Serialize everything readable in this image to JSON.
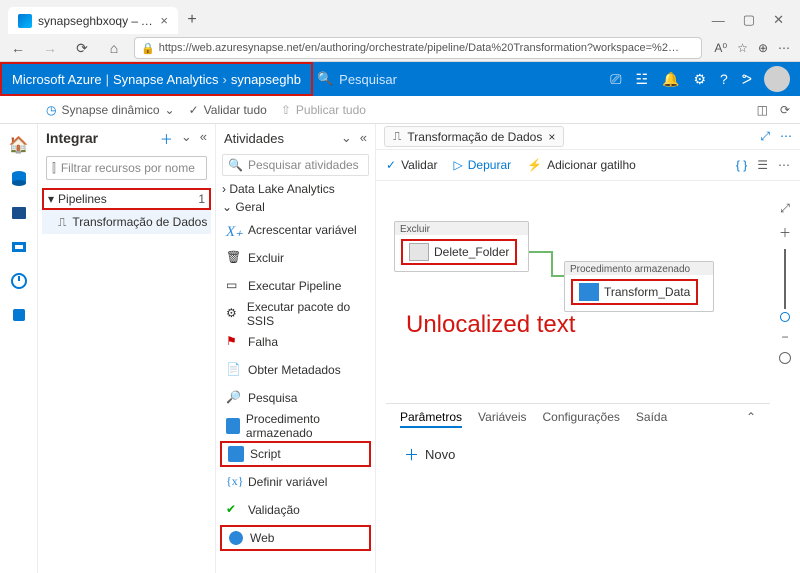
{
  "browser": {
    "tab_title": "synapseghbxoqy – Azure Synap…",
    "url": "https://web.azuresynapse.net/en/authoring/orchestrate/pipeline/Data%20Transformation?workspace=%2…"
  },
  "azure_bar": {
    "brand": "Microsoft Azure",
    "crumb1": "Synapse Analytics",
    "crumb2": "synapseghb",
    "search_placeholder": "Pesquisar"
  },
  "subbar": {
    "workspace": "Synapse dinâmico",
    "validate_all": "Validar tudo",
    "publish_all": "Publicar tudo"
  },
  "integrar": {
    "title": "Integrar",
    "filter_placeholder": "Filtrar recursos por nome",
    "pipelines_label": "Pipelines",
    "pipelines_count": "1",
    "pipeline_item": "Transformação de Dados"
  },
  "atividades": {
    "title": "Atividades",
    "search_placeholder": "Pesquisar atividades",
    "section1": "Data Lake Analytics",
    "section2": "Geral",
    "items": [
      "Acrescentar variável",
      "Excluir",
      "Executar Pipeline",
      "Executar pacote do SSIS",
      "Falha",
      "Obter Metadados",
      "Pesquisa",
      "Procedimento armazenado",
      "Script",
      "Definir variável",
      "Validação",
      "Web"
    ]
  },
  "canvas": {
    "file_tab": "Transformação de Dados",
    "toolbar": {
      "validate": "Validar",
      "debug": "Depurar",
      "add_trigger": "Adicionar gatilho"
    },
    "activity1": {
      "type": "Excluir",
      "name": "Delete_Folder"
    },
    "activity2": {
      "type": "Procedimento armazenado",
      "name": "Transform_Data"
    },
    "annotation": "Unlocalized text",
    "bottom_tabs": [
      "Parâmetros",
      "Variáveis",
      "Configurações",
      "Saída"
    ],
    "new_btn": "Novo"
  }
}
